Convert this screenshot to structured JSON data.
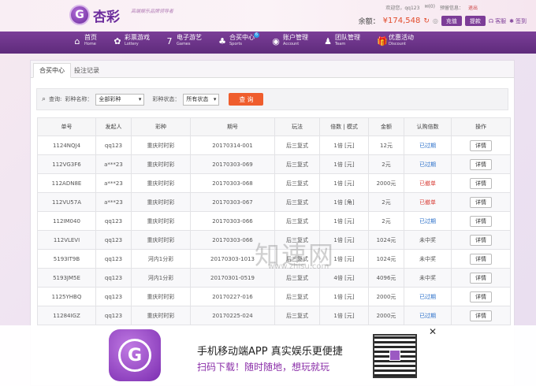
{
  "header": {
    "logo_char": "G",
    "logo_text": "杏彩",
    "slogan": "高端娱乐品牌领导者",
    "welcome": "欢迎您，",
    "username": "qq123",
    "messages": "(0)",
    "preset": "预留信息：",
    "logout": "退出",
    "balance_label": "余额：",
    "balance_value": "¥174,548",
    "recharge": "充值",
    "withdraw": "提款",
    "customer_service": "客服",
    "signin": "签到"
  },
  "nav": [
    {
      "icon": "⌂",
      "cn": "首页",
      "en": "Home"
    },
    {
      "icon": "✿",
      "cn": "彩票游戏",
      "en": "Lottery"
    },
    {
      "icon": "7",
      "cn": "电子游艺",
      "en": "Games"
    },
    {
      "icon": "♣",
      "cn": "合买中心",
      "en": "Sports",
      "badge": "6"
    },
    {
      "icon": "◉",
      "cn": "账户管理",
      "en": "Account"
    },
    {
      "icon": "♟",
      "cn": "团队管理",
      "en": "Team"
    },
    {
      "icon": "🎁",
      "cn": "优惠活动",
      "en": "Discount"
    }
  ],
  "tabs": [
    "合买中心",
    "投注记录"
  ],
  "filter": {
    "query_label": "查询:",
    "lottery_label": "彩种名称：",
    "lottery_value": "全部彩种",
    "status_label": "彩种状态：",
    "status_value": "所有状态",
    "button": "查 询"
  },
  "table": {
    "headers": [
      "单号",
      "发起人",
      "彩种",
      "期号",
      "玩法",
      "倍数 | 模式",
      "金额",
      "认购倍数",
      "操作"
    ],
    "detail_label": "详情",
    "rows": [
      [
        "1124NQJ4",
        "qq123",
        "重庆时时彩",
        "20170314-001",
        "后三复式",
        "1倍 [元]",
        "12元",
        "已过期",
        "exp"
      ],
      [
        "112VG3F6",
        "a***23",
        "重庆时时彩",
        "20170303-069",
        "后三复式",
        "1倍 [元]",
        "2元",
        "已过期",
        "exp"
      ],
      [
        "112ADN8E",
        "a***23",
        "重庆时时彩",
        "20170303-068",
        "后三复式",
        "1倍 [元]",
        "2000元",
        "已撤单",
        "cancel"
      ],
      [
        "112VU57A",
        "a***23",
        "重庆时时彩",
        "20170303-067",
        "后三复式",
        "1倍 [角]",
        "2元",
        "已撤单",
        "cancel"
      ],
      [
        "112IM040",
        "qq123",
        "重庆时时彩",
        "20170303-066",
        "后三复式",
        "1倍 [元]",
        "2元",
        "已过期",
        "exp"
      ],
      [
        "112VLEVI",
        "qq123",
        "重庆时时彩",
        "20170303-066",
        "后三复式",
        "1倍 [元]",
        "1024元",
        "未中奖",
        "none"
      ],
      [
        "5193IT9B",
        "qq123",
        "河内1分彩",
        "20170303-1013",
        "后三复式",
        "1倍 [元]",
        "1024元",
        "未中奖",
        "none"
      ],
      [
        "5193JM5E",
        "qq123",
        "河内1分彩",
        "20170301-0519",
        "后三复式",
        "4倍 [元]",
        "4096元",
        "未中奖",
        "none"
      ],
      [
        "1125YHBQ",
        "qq123",
        "重庆时时彩",
        "20170227-016",
        "后三复式",
        "1倍 [元]",
        "2000元",
        "已过期",
        "exp"
      ],
      [
        "11284IGZ",
        "qq123",
        "重庆时时彩",
        "20170225-024",
        "后三复式",
        "1倍 [元]",
        "2000元",
        "已过期",
        "exp"
      ]
    ]
  },
  "watermark": {
    "main": "知速网",
    "sub": "www.zhisu.com"
  },
  "banner": {
    "app_char": "G",
    "title": "手机移动端APP 真实娱乐更便捷",
    "subtitle": "扫码下载！随时随地，想玩就玩",
    "close": "✕"
  }
}
